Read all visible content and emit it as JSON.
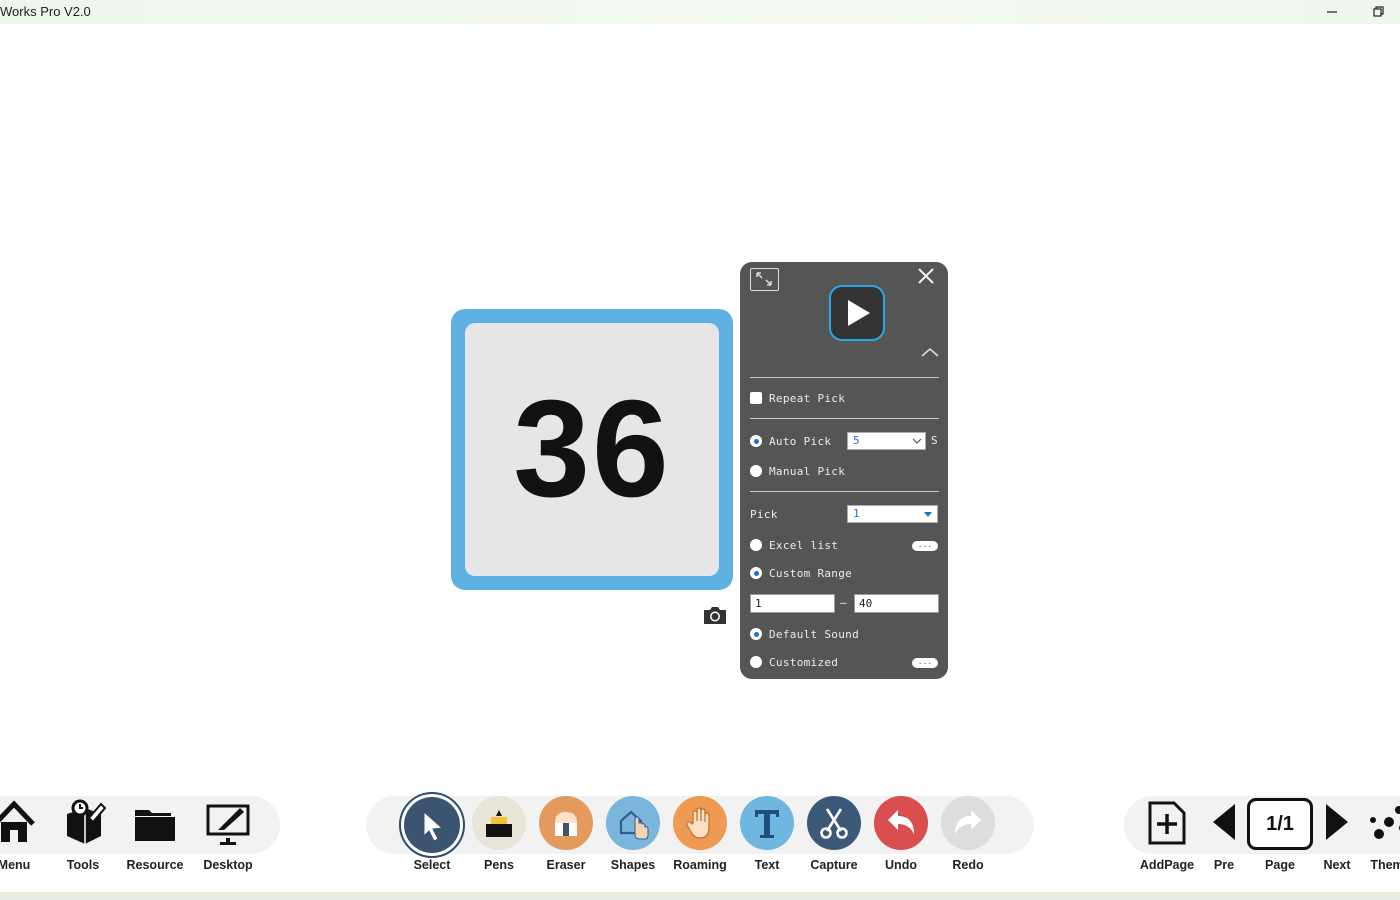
{
  "window": {
    "title": "Works Pro V2.0",
    "minimize_icon": "minimize-icon",
    "restore_icon": "restore-icon"
  },
  "picker": {
    "current_number": "36"
  },
  "panel": {
    "repeat_pick_label": "Repeat Pick",
    "auto_pick_label": "Auto Pick",
    "auto_pick_seconds": "5",
    "seconds_unit": "S",
    "manual_pick_label": "Manual Pick",
    "pick_label": "Pick",
    "pick_count": "1",
    "excel_list_label": "Excel list",
    "custom_range_label": "Custom Range",
    "range_from": "1",
    "range_separator": "–",
    "range_to": "40",
    "default_sound_label": "Default Sound",
    "customized_label": "Customized",
    "browse_label": "...",
    "selected_pick_mode": "Auto Pick",
    "selected_source": "Custom Range",
    "selected_sound": "Default Sound",
    "repeat_pick_checked": false
  },
  "toolbar": {
    "left": [
      {
        "label": "Menu",
        "icon": "home-icon"
      },
      {
        "label": "Tools",
        "icon": "toolbox-icon"
      },
      {
        "label": "Resource",
        "icon": "folder-icon"
      },
      {
        "label": "Desktop",
        "icon": "desktop-icon"
      }
    ],
    "center": [
      {
        "label": "Select",
        "icon": "cursor-icon",
        "color": "#3b5570",
        "active": true
      },
      {
        "label": "Pens",
        "icon": "pen-icon",
        "color": "#e8e4d8"
      },
      {
        "label": "Eraser",
        "icon": "eraser-icon",
        "color": "#e39a5c"
      },
      {
        "label": "Shapes",
        "icon": "shapes-icon",
        "color": "#7ab5dc"
      },
      {
        "label": "Roaming",
        "icon": "hand-icon",
        "color": "#ee9a52"
      },
      {
        "label": "Text",
        "icon": "text-icon",
        "color": "#6fb6e0"
      },
      {
        "label": "Capture",
        "icon": "scissors-icon",
        "color": "#3b5878"
      },
      {
        "label": "Undo",
        "icon": "undo-icon",
        "color": "#d94e4e"
      },
      {
        "label": "Redo",
        "icon": "redo-icon",
        "color": "#dddddd"
      }
    ],
    "right": [
      {
        "label": "AddPage",
        "icon": "add-page-icon"
      },
      {
        "label": "Pre",
        "icon": "previous-arrow-icon"
      },
      {
        "label": "Page",
        "icon": "page-counter"
      },
      {
        "label": "Next",
        "icon": "next-arrow-icon"
      },
      {
        "label": "Them",
        "icon": "theme-icon"
      }
    ],
    "page_counter": "1/1"
  }
}
